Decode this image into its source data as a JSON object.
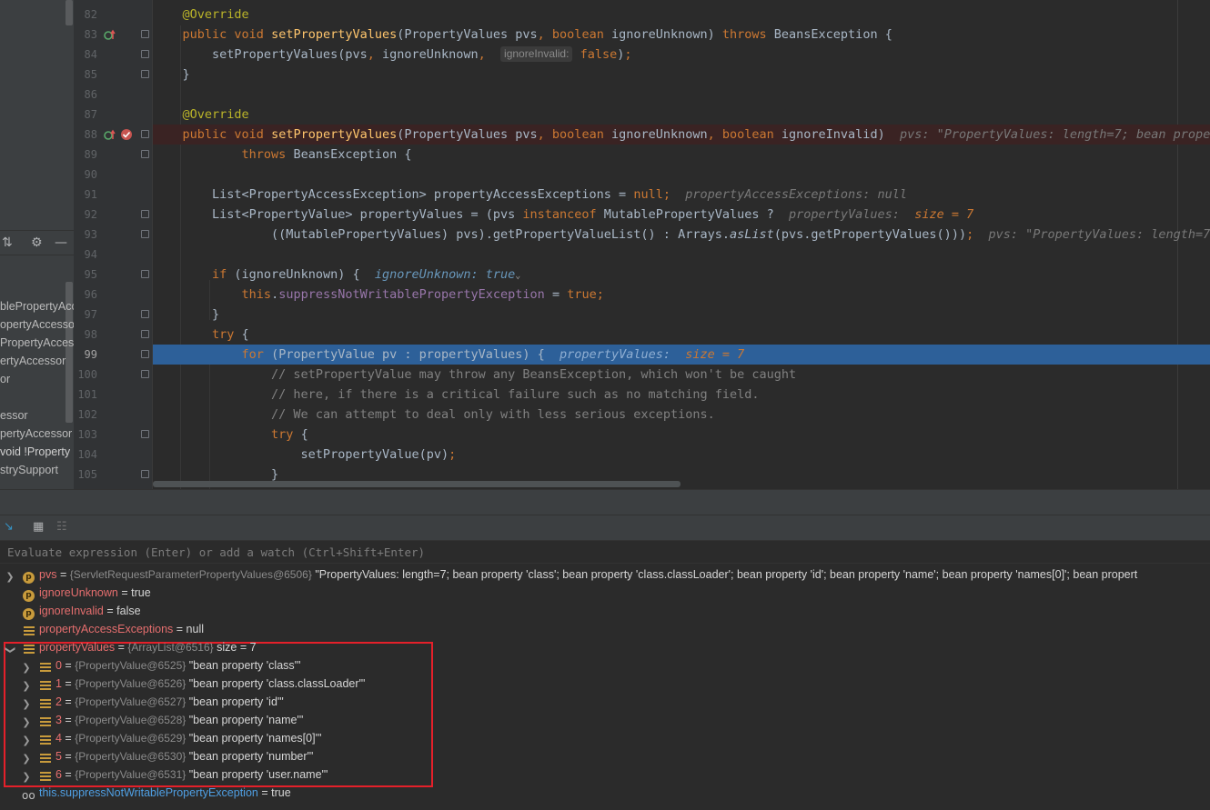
{
  "project_panel": {
    "items": [
      "blePropertyAcc",
      "opertyAccessor",
      "PropertyAcces",
      "ertyAccessor",
      "or",
      "",
      "essor",
      "pertyAccessor",
      "void !Property",
      "stryS​upport"
    ]
  },
  "editor": {
    "lines": [
      {
        "n": "82"
      },
      {
        "n": "83"
      },
      {
        "n": "84"
      },
      {
        "n": "85"
      },
      {
        "n": "86"
      },
      {
        "n": "87"
      },
      {
        "n": "88"
      },
      {
        "n": "89"
      },
      {
        "n": "90"
      },
      {
        "n": "91"
      },
      {
        "n": "92"
      },
      {
        "n": "93"
      },
      {
        "n": "94"
      },
      {
        "n": "95"
      },
      {
        "n": "96"
      },
      {
        "n": "97"
      },
      {
        "n": "98"
      },
      {
        "n": "99"
      },
      {
        "n": "100"
      },
      {
        "n": "101"
      },
      {
        "n": "102"
      },
      {
        "n": "103"
      },
      {
        "n": "104"
      },
      {
        "n": "105"
      }
    ],
    "current_line": "99",
    "param_hint": "ignoreInvalid:",
    "hint_88": "pvs: \"PropertyValues: length=7; bean propert",
    "hint_91": "propertyAccessExceptions: null",
    "hint_92_name": "propertyValues:",
    "hint_92_size": "size = 7",
    "hint_93": "pvs: \"PropertyValues: length=7;",
    "hint_95": "ignoreUnknown: true",
    "hint_99_name": "propertyValues:",
    "hint_99_size": "size = 7",
    "comment_100": "// setPropertyValue may throw any BeansException, which won't be caught",
    "comment_101": "// here, if there is a critical failure such as no matching field.",
    "comment_102": "// We can attempt to deal only with less serious exceptions."
  },
  "debugger": {
    "eval_placeholder": "Evaluate expression (Enter) or add a watch (Ctrl+Shift+Enter)",
    "variables": [
      {
        "name": "pvs",
        "type": "{ServletRequestParameterPropertyValues@6506}",
        "value": "\"PropertyValues: length=7; bean property 'class'; bean property 'class.classLoader'; bean property 'id'; bean property 'name'; bean property 'names[0]'; bean propert"
      },
      {
        "name": "ignoreUnknown",
        "eq": "= true"
      },
      {
        "name": "ignoreInvalid",
        "eq": "= false"
      },
      {
        "name": "propertyAccessExceptions",
        "eq": "= null"
      },
      {
        "name": "propertyValues",
        "type": "{ArrayList@6516}",
        "value": "size = 7"
      }
    ],
    "elements": [
      {
        "idx": "0",
        "type": "{PropertyValue@6525}",
        "value": "\"bean property 'class'\""
      },
      {
        "idx": "1",
        "type": "{PropertyValue@6526}",
        "value": "\"bean property 'class.classLoader'\""
      },
      {
        "idx": "2",
        "type": "{PropertyValue@6527}",
        "value": "\"bean property 'id'\""
      },
      {
        "idx": "3",
        "type": "{PropertyValue@6528}",
        "value": "\"bean property 'name'\""
      },
      {
        "idx": "4",
        "type": "{PropertyValue@6529}",
        "value": "\"bean property 'names[0]'\""
      },
      {
        "idx": "5",
        "type": "{PropertyValue@6530}",
        "value": "\"bean property 'number'\""
      },
      {
        "idx": "6",
        "type": "{PropertyValue@6531}",
        "value": "\"bean property 'user.name'\""
      }
    ],
    "watch": {
      "name": "this.suppressNotWritablePropertyException",
      "eq": "= true"
    }
  },
  "colors": {
    "highlight": "#2d6099",
    "annotation_box": "#e5202a"
  }
}
